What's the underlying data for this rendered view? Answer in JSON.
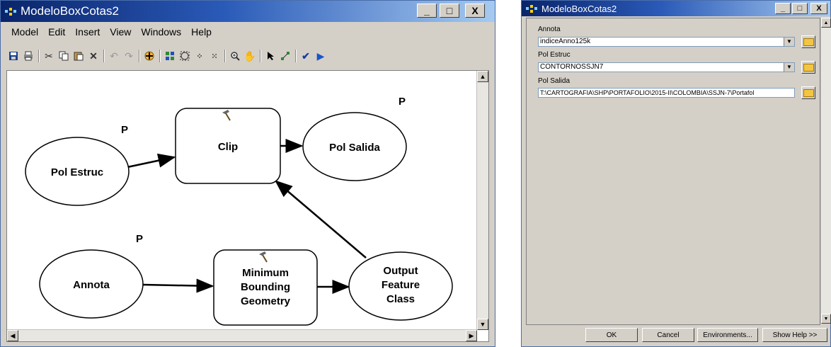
{
  "left_window": {
    "title": "ModeloBoxCotas2",
    "controls": {
      "minimize": "_",
      "maximize": "□",
      "close": "X"
    },
    "menu": [
      "Model",
      "Edit",
      "Insert",
      "View",
      "Windows",
      "Help"
    ],
    "toolbar_icons": [
      "save-icon",
      "print-icon",
      "cut-icon",
      "copy-icon",
      "paste-icon",
      "delete-icon",
      "undo-icon",
      "redo-icon",
      "add-data-icon",
      "auto-layout-icon",
      "full-extent-icon",
      "zoom-in-fixed-icon",
      "zoom-out-fixed-icon",
      "zoom-in-icon",
      "pan-icon",
      "select-icon",
      "connect-icon",
      "validate-icon",
      "run-icon"
    ],
    "diagram": {
      "nodes": {
        "pol_estruc": "Pol Estruc",
        "clip": "Clip",
        "pol_salida": "Pol Salida",
        "annota": "Annota",
        "min_bounding_1": "Minimum",
        "min_bounding_2": "Bounding",
        "min_bounding_3": "Geometry",
        "output_1": "Output",
        "output_2": "Feature",
        "output_3": "Class"
      },
      "param_marker": "P"
    }
  },
  "right_window": {
    "title": "ModeloBoxCotas2",
    "controls": {
      "minimize": "_",
      "maximize": "□",
      "close": "X"
    },
    "fields": [
      {
        "label": "Annota",
        "value": "indiceAnno125k",
        "dropdown": true
      },
      {
        "label": "Pol Estruc",
        "value": "CONTORNOSSJN7",
        "dropdown": true
      },
      {
        "label": "Pol Salida",
        "value": "T:\\CARTOGRAFIA\\SHP\\PORTAFOLIO\\2015-II\\COLOMBIA\\SSJN-7\\Portafol",
        "dropdown": false
      }
    ],
    "buttons": {
      "ok": "OK",
      "cancel": "Cancel",
      "environments": "Environments...",
      "show_help": "Show Help >>"
    }
  }
}
